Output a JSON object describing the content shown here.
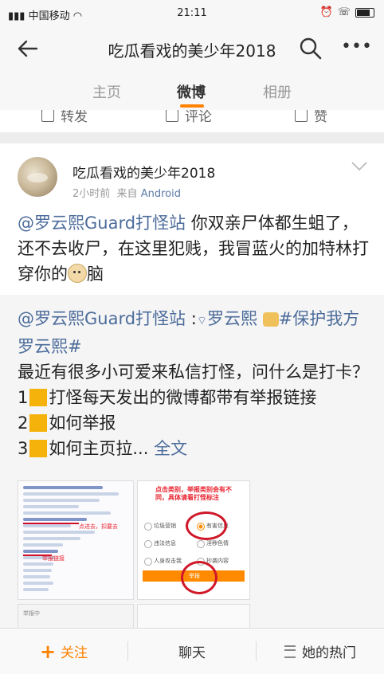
{
  "status_bar": {
    "carrier": "中国移动",
    "time": "21:11"
  },
  "nav": {
    "title": "吃瓜看戏的美少年2018",
    "back_icon": "back-arrow-icon",
    "search_icon": "search-icon",
    "more_icon": "more-icon"
  },
  "tabs": [
    {
      "label": "主页",
      "active": false
    },
    {
      "label": "微博",
      "active": true
    },
    {
      "label": "相册",
      "active": false
    }
  ],
  "previous_post_actions": [
    "转发",
    "评论",
    "赞"
  ],
  "post": {
    "username": "吃瓜看戏的美少年2018",
    "time": "2小时前",
    "source_prefix": "来自",
    "source": "Android",
    "mention": "@罗云熙Guard打怪站",
    "text_part1": " 你双亲尸体都生蛆了，还不去收尸，在这里犯贱，我冒蓝火的加特林打穿你的",
    "text_part2": "脑"
  },
  "repost": {
    "mention": "@罗云熙Guard打怪站",
    "colon": " :",
    "mention2": "罗云熙",
    "hashtag": "#保护我方罗云熙#",
    "line1": "最近有很多小可爱来私信打怪，问什么是打卡？",
    "item1_num": "1",
    "item1": "打怪每天发出的微博都带有举报链接",
    "item2_num": "2",
    "item2": "如何举报",
    "item3_num": "3",
    "item3": "如何主页拉...",
    "full_text": " 全文",
    "img1_note1": "点进去，扣要去",
    "img1_note2": "举报链接",
    "img2_note": "点击类别，举报类别会有不同，具体请看打怪标注",
    "img2_opt_a": "垃圾营销",
    "img2_opt_b": "有害信息",
    "img2_opt_c": "违法信息",
    "img2_opt_d": "淫秽色情",
    "img2_opt_e": "人身攻击我",
    "img2_opt_f": "抄袭内容",
    "img2_btn": "举报",
    "img3_label": "举报中"
  },
  "bottom_bar": {
    "follow": "关注",
    "follow_plus": "+",
    "chat": "聊天",
    "hot": "她的热门"
  },
  "colors": {
    "accent": "#ff8200",
    "link": "#4c6c9b"
  }
}
